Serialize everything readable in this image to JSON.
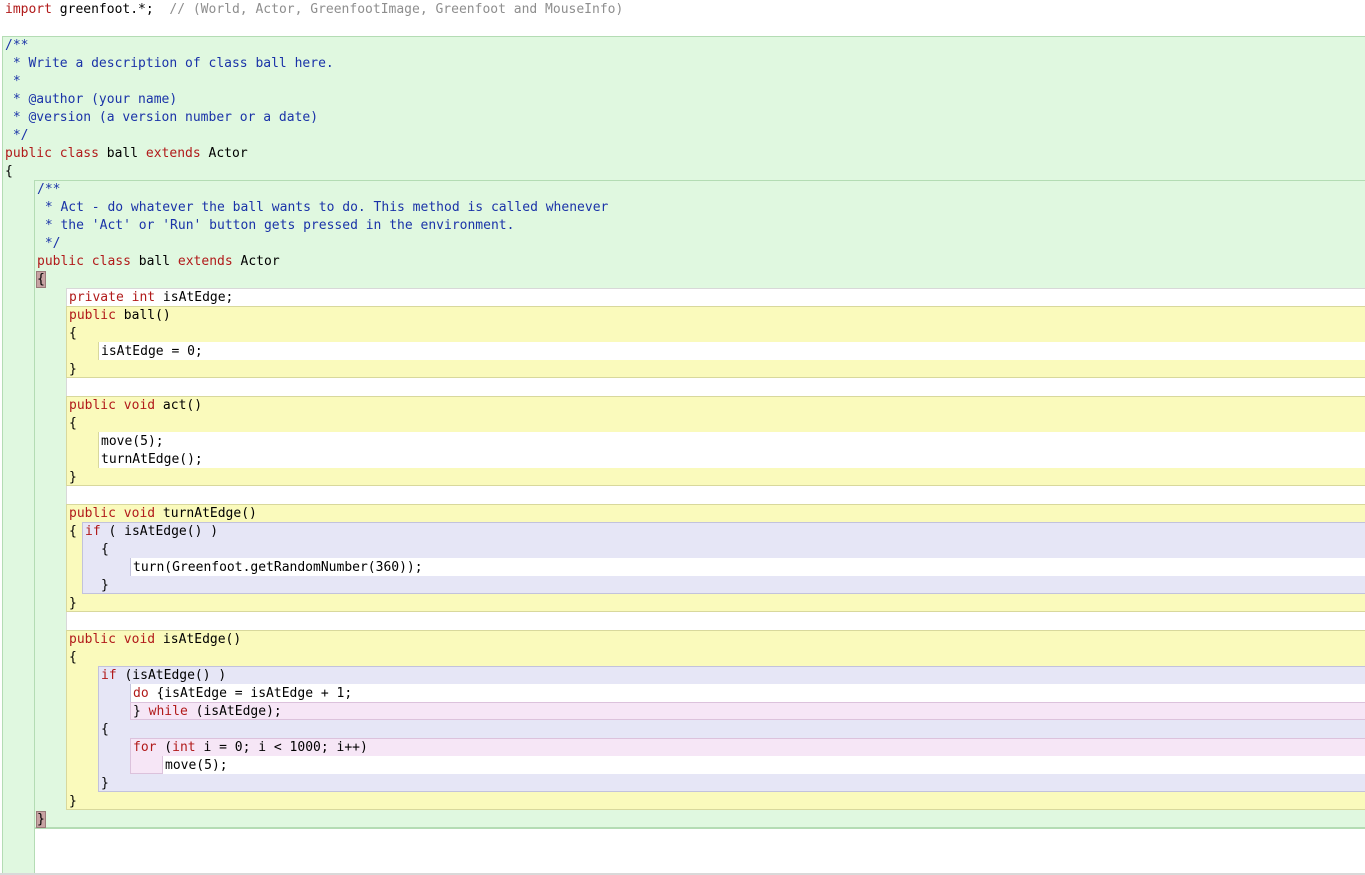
{
  "editor": {
    "import_line": {
      "kw": "import",
      "rest": " greenfoot.*;",
      "comment": "  // (World, Actor, GreenfootImage, Greenfoot and MouseInfo)"
    },
    "class_doc": [
      "/**",
      " * Write a description of class ball here.",
      " *",
      " * @author (your name)",
      " * @version (a version number or a date)",
      " */"
    ],
    "class_decl": {
      "kw1": "public",
      "kw2": " class",
      "name": " ball ",
      "kw3": "extends",
      "super": " Actor"
    },
    "open_brace": "{",
    "close_brace": "}",
    "inner_doc": [
      "/**",
      " * Act - do whatever the ball wants to do. This method is called whenever",
      " * the 'Act' or 'Run' button gets pressed in the environment.",
      " */"
    ],
    "inner_decl": {
      "kw1": "public",
      "kw2": " class",
      "name": " ball ",
      "kw3": "extends",
      "super": " Actor"
    },
    "field": {
      "kw1": "private",
      "kw2": " int",
      "rest": " isAtEdge;"
    },
    "ctor": {
      "kw": "public",
      "rest": " ball()",
      "body": "isAtEdge = 0;"
    },
    "act": {
      "kw1": "public",
      "kw2": " void",
      "rest": " act()",
      "body": [
        "move(5);",
        "turnAtEdge();"
      ]
    },
    "turn_at_edge": {
      "kw1": "public",
      "kw2": " void",
      "rest": " turnAtEdge()",
      "if_kw": "if",
      "if_rest": " ( isAtEdge() )",
      "body": "turn(Greenfoot.getRandomNumber(360));"
    },
    "is_at_edge": {
      "kw1": "public",
      "kw2": " void",
      "rest": " isAtEdge()",
      "if_kw": "if",
      "if_rest": " (isAtEdge() )",
      "do_kw": "do",
      "do_rest": " {isAtEdge = isAtEdge + 1;",
      "while_pre": "} ",
      "while_kw": "while",
      "while_rest": " (isAtEdge);",
      "for_kw": "for",
      "for_open": " (",
      "for_int": "int",
      "for_rest": " i = 0; i < 1000; i++)",
      "for_body": "move(5);"
    }
  }
}
